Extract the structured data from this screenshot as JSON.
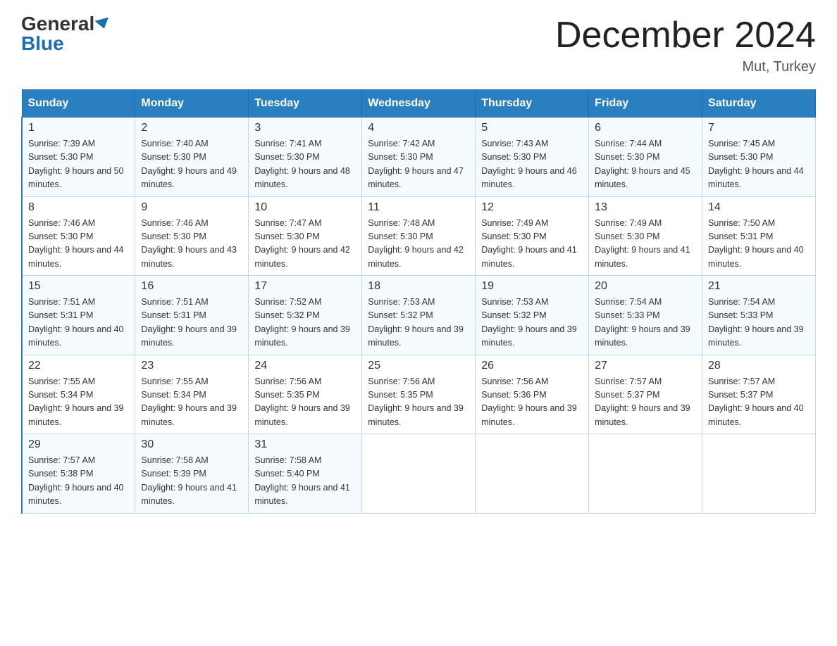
{
  "header": {
    "logo_general": "General",
    "logo_blue": "Blue",
    "month_title": "December 2024",
    "location": "Mut, Turkey"
  },
  "days_of_week": [
    "Sunday",
    "Monday",
    "Tuesday",
    "Wednesday",
    "Thursday",
    "Friday",
    "Saturday"
  ],
  "weeks": [
    [
      {
        "day": "1",
        "sunrise": "7:39 AM",
        "sunset": "5:30 PM",
        "daylight": "9 hours and 50 minutes."
      },
      {
        "day": "2",
        "sunrise": "7:40 AM",
        "sunset": "5:30 PM",
        "daylight": "9 hours and 49 minutes."
      },
      {
        "day": "3",
        "sunrise": "7:41 AM",
        "sunset": "5:30 PM",
        "daylight": "9 hours and 48 minutes."
      },
      {
        "day": "4",
        "sunrise": "7:42 AM",
        "sunset": "5:30 PM",
        "daylight": "9 hours and 47 minutes."
      },
      {
        "day": "5",
        "sunrise": "7:43 AM",
        "sunset": "5:30 PM",
        "daylight": "9 hours and 46 minutes."
      },
      {
        "day": "6",
        "sunrise": "7:44 AM",
        "sunset": "5:30 PM",
        "daylight": "9 hours and 45 minutes."
      },
      {
        "day": "7",
        "sunrise": "7:45 AM",
        "sunset": "5:30 PM",
        "daylight": "9 hours and 44 minutes."
      }
    ],
    [
      {
        "day": "8",
        "sunrise": "7:46 AM",
        "sunset": "5:30 PM",
        "daylight": "9 hours and 44 minutes."
      },
      {
        "day": "9",
        "sunrise": "7:46 AM",
        "sunset": "5:30 PM",
        "daylight": "9 hours and 43 minutes."
      },
      {
        "day": "10",
        "sunrise": "7:47 AM",
        "sunset": "5:30 PM",
        "daylight": "9 hours and 42 minutes."
      },
      {
        "day": "11",
        "sunrise": "7:48 AM",
        "sunset": "5:30 PM",
        "daylight": "9 hours and 42 minutes."
      },
      {
        "day": "12",
        "sunrise": "7:49 AM",
        "sunset": "5:30 PM",
        "daylight": "9 hours and 41 minutes."
      },
      {
        "day": "13",
        "sunrise": "7:49 AM",
        "sunset": "5:30 PM",
        "daylight": "9 hours and 41 minutes."
      },
      {
        "day": "14",
        "sunrise": "7:50 AM",
        "sunset": "5:31 PM",
        "daylight": "9 hours and 40 minutes."
      }
    ],
    [
      {
        "day": "15",
        "sunrise": "7:51 AM",
        "sunset": "5:31 PM",
        "daylight": "9 hours and 40 minutes."
      },
      {
        "day": "16",
        "sunrise": "7:51 AM",
        "sunset": "5:31 PM",
        "daylight": "9 hours and 39 minutes."
      },
      {
        "day": "17",
        "sunrise": "7:52 AM",
        "sunset": "5:32 PM",
        "daylight": "9 hours and 39 minutes."
      },
      {
        "day": "18",
        "sunrise": "7:53 AM",
        "sunset": "5:32 PM",
        "daylight": "9 hours and 39 minutes."
      },
      {
        "day": "19",
        "sunrise": "7:53 AM",
        "sunset": "5:32 PM",
        "daylight": "9 hours and 39 minutes."
      },
      {
        "day": "20",
        "sunrise": "7:54 AM",
        "sunset": "5:33 PM",
        "daylight": "9 hours and 39 minutes."
      },
      {
        "day": "21",
        "sunrise": "7:54 AM",
        "sunset": "5:33 PM",
        "daylight": "9 hours and 39 minutes."
      }
    ],
    [
      {
        "day": "22",
        "sunrise": "7:55 AM",
        "sunset": "5:34 PM",
        "daylight": "9 hours and 39 minutes."
      },
      {
        "day": "23",
        "sunrise": "7:55 AM",
        "sunset": "5:34 PM",
        "daylight": "9 hours and 39 minutes."
      },
      {
        "day": "24",
        "sunrise": "7:56 AM",
        "sunset": "5:35 PM",
        "daylight": "9 hours and 39 minutes."
      },
      {
        "day": "25",
        "sunrise": "7:56 AM",
        "sunset": "5:35 PM",
        "daylight": "9 hours and 39 minutes."
      },
      {
        "day": "26",
        "sunrise": "7:56 AM",
        "sunset": "5:36 PM",
        "daylight": "9 hours and 39 minutes."
      },
      {
        "day": "27",
        "sunrise": "7:57 AM",
        "sunset": "5:37 PM",
        "daylight": "9 hours and 39 minutes."
      },
      {
        "day": "28",
        "sunrise": "7:57 AM",
        "sunset": "5:37 PM",
        "daylight": "9 hours and 40 minutes."
      }
    ],
    [
      {
        "day": "29",
        "sunrise": "7:57 AM",
        "sunset": "5:38 PM",
        "daylight": "9 hours and 40 minutes."
      },
      {
        "day": "30",
        "sunrise": "7:58 AM",
        "sunset": "5:39 PM",
        "daylight": "9 hours and 41 minutes."
      },
      {
        "day": "31",
        "sunrise": "7:58 AM",
        "sunset": "5:40 PM",
        "daylight": "9 hours and 41 minutes."
      },
      null,
      null,
      null,
      null
    ]
  ]
}
